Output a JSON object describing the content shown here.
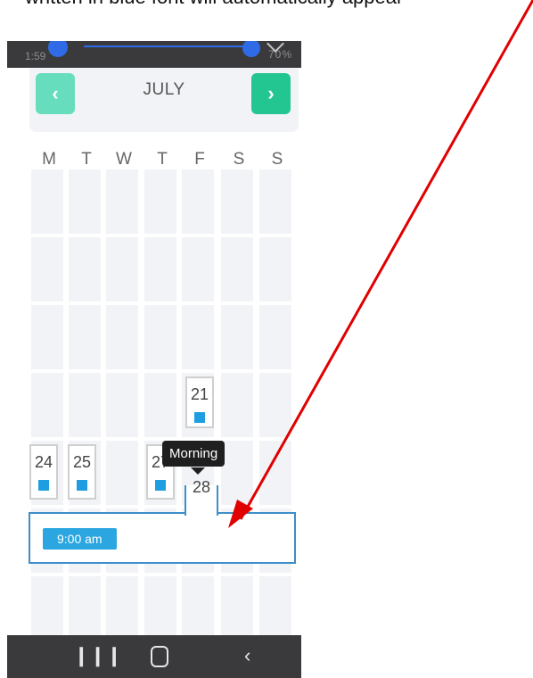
{
  "caption": "written in blue font will automatically appear",
  "status_bar": {
    "left_text": "1:59",
    "right_text": "70%"
  },
  "calendar": {
    "month": "JULY",
    "prev_icon": "chevron-left-icon",
    "next_icon": "chevron-right-icon",
    "weekdays": [
      "M",
      "T",
      "W",
      "T",
      "F",
      "S",
      "S"
    ],
    "days": [
      {
        "label": "21"
      },
      {
        "label": "24"
      },
      {
        "label": "25"
      },
      {
        "label": "27"
      },
      {
        "label": "28"
      }
    ],
    "tooltip": "Morning",
    "detail": {
      "time": "9:00 am"
    }
  },
  "nav_bar": {
    "recent_icon": "recent-apps-icon",
    "home_icon": "home-icon",
    "back_icon": "back-icon"
  },
  "colors": {
    "arrow": "#e10000",
    "accent_blue": "#2ba6e0",
    "green_light": "#66ddbd",
    "green": "#23c591"
  }
}
